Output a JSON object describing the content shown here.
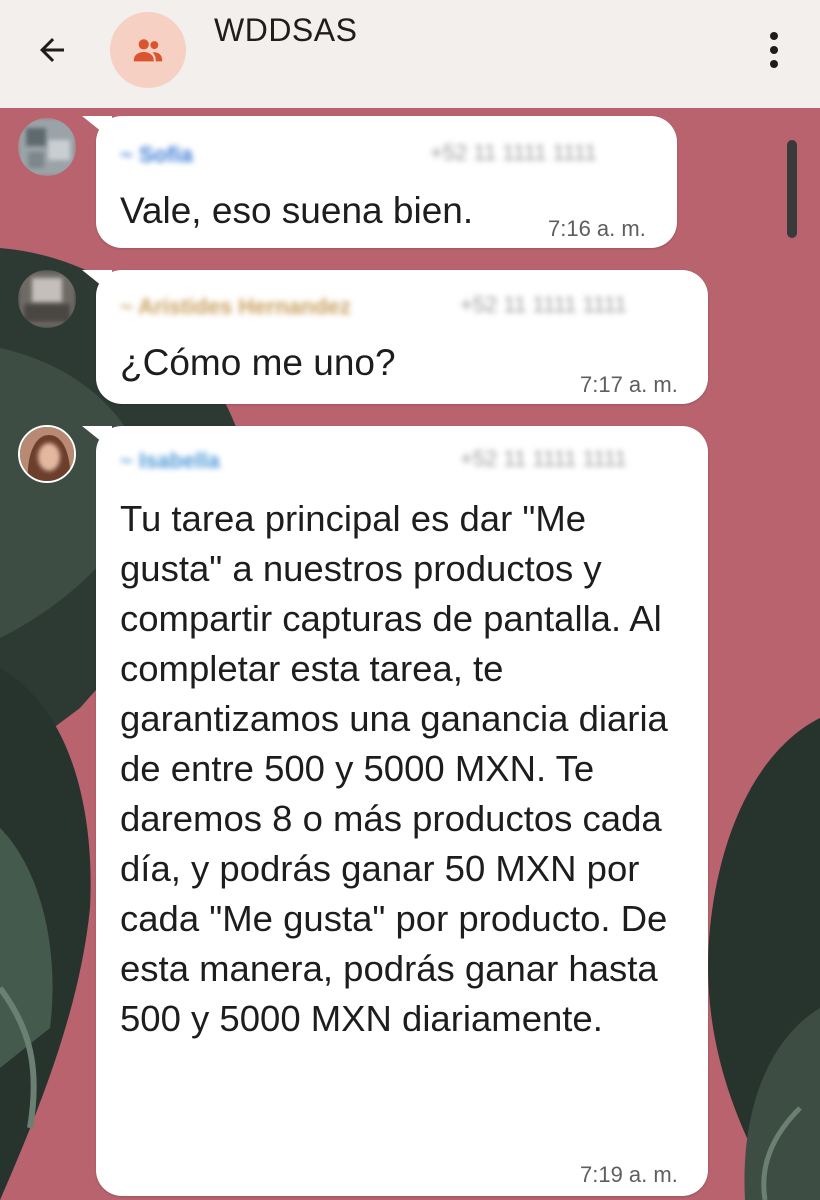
{
  "header": {
    "title": "WDDSAS",
    "back_icon": "arrow-left-icon",
    "group_icon": "group-icon",
    "menu_icon": "more-vert-icon"
  },
  "messages": [
    {
      "sender_name": "~ Sofia",
      "sender_phone": "+52 11 1111 1111",
      "text": "Vale, eso suena bien.",
      "time": "7:16 a. m."
    },
    {
      "sender_name": "~ Aristides Hernandez",
      "sender_phone": "+52 11 1111 1111",
      "text": "¿Cómo me uno?",
      "time": "7:17 a. m."
    },
    {
      "sender_name": "~ Isabella",
      "sender_phone": "+52 11 1111 1111",
      "text": "Tu tarea principal es dar \"Me gusta\" a nuestros productos y compartir capturas de pantalla. Al completar esta tarea, te garantizamos una ganancia diaria de entre 500 y 5000 MXN. Te daremos 8 o más productos cada día, y podrás ganar 50 MXN por cada \"Me gusta\" por producto. De esta manera, podrás ganar hasta 500 y 5000 MXN diariamente.",
      "time": "7:19 a. m."
    }
  ],
  "colors": {
    "header_bg": "#f3efec",
    "wallpaper": "#b8636d",
    "bubble": "#ffffff",
    "sender_name": "#3e7ed6",
    "group_avatar_bg": "#f6d0c2",
    "group_icon": "#d9542f"
  }
}
